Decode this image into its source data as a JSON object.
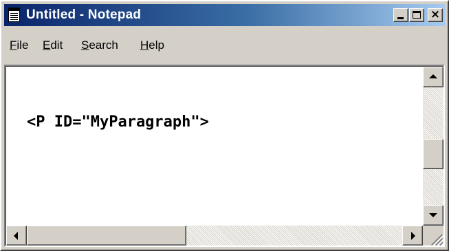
{
  "window": {
    "title": "Untitled - Notepad",
    "icon": "notepad-icon",
    "controls": {
      "minimize": "minimize-icon",
      "maximize": "maximize-icon",
      "close": "close-icon",
      "close_glyph": "×"
    }
  },
  "menu": {
    "items": [
      {
        "accel": "F",
        "rest": "ile"
      },
      {
        "accel": "E",
        "rest": "dit"
      },
      {
        "accel": "S",
        "rest": "earch"
      },
      {
        "accel": "H",
        "rest": "elp"
      }
    ]
  },
  "editor": {
    "content": "<P ID=\"MyParagraph\">"
  },
  "scrollbars": {
    "vertical": {
      "up": "arrow-up-icon",
      "down": "arrow-down-icon"
    },
    "horizontal": {
      "left": "arrow-left-icon",
      "right": "arrow-right-icon"
    }
  },
  "colors": {
    "titlebar_start": "#0a246a",
    "titlebar_end": "#a6caf0",
    "face": "#d4d0c8"
  }
}
